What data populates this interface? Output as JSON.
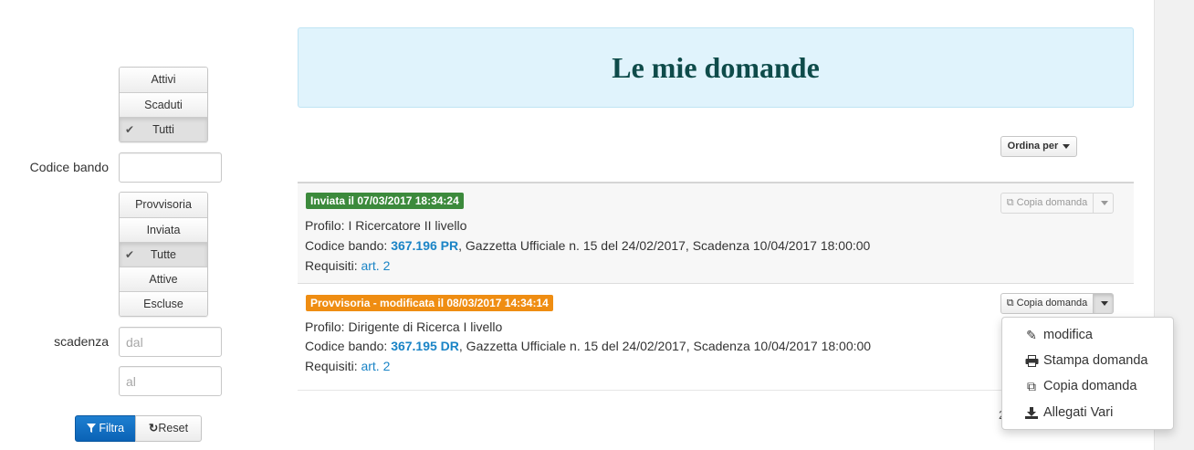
{
  "filters": {
    "status_group": [
      {
        "label": "Attivi",
        "active": false
      },
      {
        "label": "Scaduti",
        "active": false
      },
      {
        "label": "Tutti",
        "active": true
      }
    ],
    "codice_bando_label": "Codice bando",
    "codice_bando_value": "",
    "state_group": [
      {
        "label": "Provvisoria",
        "active": false
      },
      {
        "label": "Inviata",
        "active": false
      },
      {
        "label": "Tutte",
        "active": true
      },
      {
        "label": "Attive",
        "active": false
      },
      {
        "label": "Escluse",
        "active": false
      }
    ],
    "scadenza_label": "scadenza",
    "dal_placeholder": "dal",
    "al_placeholder": "al",
    "filtra_label": "Filtra",
    "reset_label": "Reset"
  },
  "header": {
    "title": "Le mie domande"
  },
  "sort_button_label": "Ordina per",
  "applications": [
    {
      "badge": "Inviata il 07/03/2017 18:34:24",
      "badge_color": "#3c8a3c",
      "profilo_prefix": "Profilo: ",
      "profilo": "I Ricercatore II livello",
      "codice_prefix": "Codice bando: ",
      "codice": "367.196 PR",
      "codice_suffix": ", Gazzetta Ufficiale n. 15 del 24/02/2017, Scadenza 10/04/2017 18:00:00",
      "requisiti_prefix": "Requisiti: ",
      "requisiti": "art. 2",
      "copy_label": "Copia domanda",
      "copy_enabled": false
    },
    {
      "badge": "Provvisoria - modificata il 08/03/2017 14:34:14",
      "badge_color": "#ef8d12",
      "profilo_prefix": "Profilo: ",
      "profilo": "Dirigente di Ricerca I livello",
      "codice_prefix": "Codice bando: ",
      "codice": "367.195 DR",
      "codice_suffix": ", Gazzetta Ufficiale n. 15 del 24/02/2017, Scadenza 10/04/2017 18:00:00",
      "requisiti_prefix": "Requisiti: ",
      "requisiti": "art. 2",
      "copy_label": "Copia domanda",
      "copy_enabled": true
    }
  ],
  "pagination_text": "2",
  "dropdown_menu": [
    {
      "label": "modifica",
      "icon": "pencil-icon"
    },
    {
      "label": "Stampa domanda",
      "icon": "print-icon"
    },
    {
      "label": "Copia domanda",
      "icon": "copy-icon"
    },
    {
      "label": "Allegati Vari",
      "icon": "download-icon"
    }
  ],
  "colors": {
    "header_bg": "#e0f3fc",
    "header_text": "#0e4b4a",
    "link": "#1a84c6",
    "primary": "#0a62b6"
  }
}
